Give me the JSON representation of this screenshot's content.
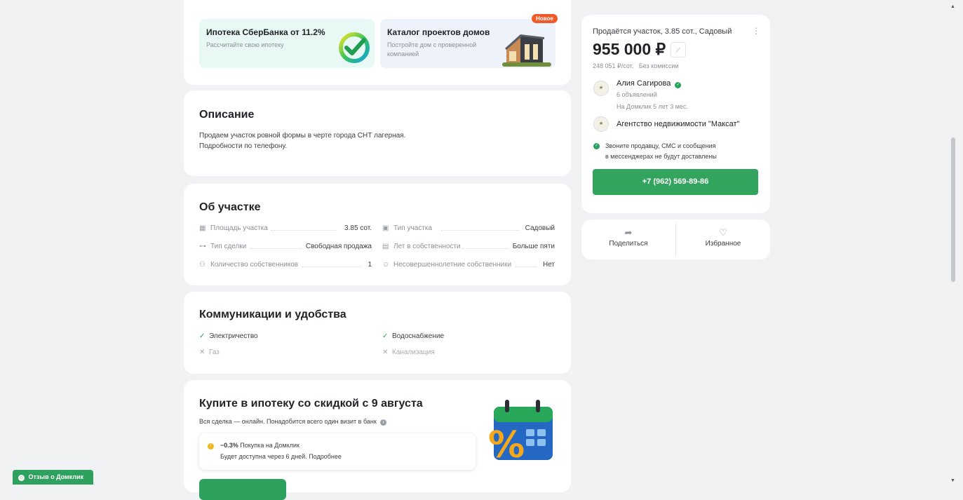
{
  "promos": {
    "ipoteka": {
      "title": "Ипотека СберБанка от 11.2%",
      "subtitle": "Рассчитайте свою ипотеку"
    },
    "catalog": {
      "title": "Каталог проектов домов",
      "subtitle": "Постройте дом с проверенной компанией",
      "badge": "Новое"
    }
  },
  "description": {
    "heading": "Описание",
    "lines": [
      "Продаем участок ровной формы в черте города СНТ лагерная.",
      "Подробности по телефону."
    ]
  },
  "about": {
    "heading": "Об участке",
    "props": [
      {
        "icon": "area-icon",
        "label": "Площадь участка",
        "value": "3.85 сот."
      },
      {
        "icon": "plot-type-icon",
        "label": "Тип участка",
        "value": "Садовый"
      },
      {
        "icon": "key-icon",
        "label": "Тип сделки",
        "value": "Свободная продажа"
      },
      {
        "icon": "calendar-icon",
        "label": "Лет в собственности",
        "value": "Больше пяти"
      },
      {
        "icon": "people-icon",
        "label": "Количество собственников",
        "value": "1"
      },
      {
        "icon": "child-icon",
        "label": "Несовершеннолетние собственники",
        "value": "Нет"
      }
    ]
  },
  "communications": {
    "heading": "Коммуникации и удобства",
    "items": [
      {
        "label": "Электричество",
        "available": true
      },
      {
        "label": "Водоснабжение",
        "available": true
      },
      {
        "label": "Газ",
        "available": false
      },
      {
        "label": "Канализация",
        "available": false
      }
    ]
  },
  "mortgage": {
    "heading": "Купите в ипотеку со скидкой с 9 августа",
    "subtitle": "Вся сделка — онлайн. Понадобится всего один визит в банк",
    "discount": "−0.3%",
    "discount_label": "Покупка на Домклик",
    "note": "Будет доступна через 6 дней. Подробнее"
  },
  "seller": {
    "listing_title": "Продаётся участок, 3.85 сот., Садовый",
    "price": "955 000 ₽",
    "price_per_unit": "248 051 ₽/сот.",
    "commission": "Без комиссии",
    "agent_name": "Алия Сагирова",
    "agent_listings": "6 объявлений",
    "agent_tenure": "На Домклик 5 лет 3 мес.",
    "agency": "Агентство недвижимости \"Максат\"",
    "notice_line1": "Звоните продавцу, СМС и сообщения",
    "notice_line2": "в мессенджерах не будут доставлены",
    "phone": "+7 (962) 569-89-86"
  },
  "share": {
    "share_label": "Поделиться",
    "favorite_label": "Избранное"
  },
  "feedback": {
    "label": "Отзыв о Домклик"
  },
  "colors": {
    "accent_green": "#2fa15f",
    "badge_orange": "#f05a2a",
    "background": "#f1f2f4"
  }
}
